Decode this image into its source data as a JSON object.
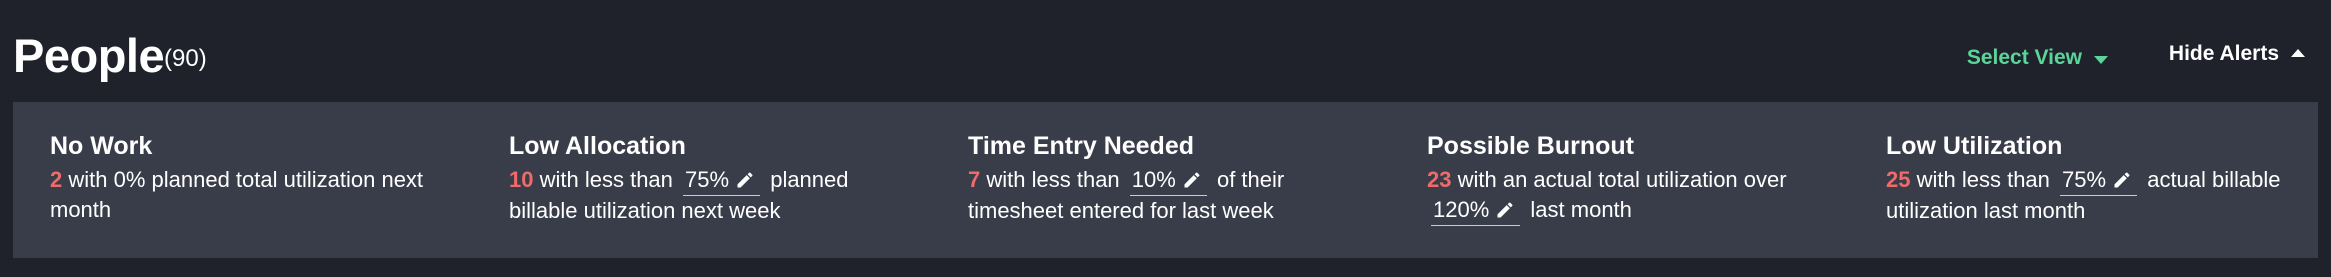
{
  "header": {
    "title": "People",
    "count": "(90)",
    "select_view_label": "Select View",
    "hide_alerts_label": "Hide Alerts"
  },
  "colors": {
    "background": "#1f222b",
    "panel": "#393d4a",
    "accent_green": "#5bd49a",
    "alert_red": "#f06a6a"
  },
  "alerts": [
    {
      "title": "No Work",
      "count": "2",
      "text_before": "with 0% planned total utilization next month"
    },
    {
      "title": "Low Allocation",
      "count": "10",
      "text_before": "with less than",
      "threshold": "75%",
      "text_after": "planned billable utilization next week"
    },
    {
      "title": "Time Entry Needed",
      "count": "7",
      "text_before": "with less than",
      "threshold": "10%",
      "text_after": "of their timesheet entered for last week"
    },
    {
      "title": "Possible Burnout",
      "count": "23",
      "text_before": "with an actual total utilization over",
      "threshold": "120%",
      "text_after": "last month"
    },
    {
      "title": "Low Utilization",
      "count": "25",
      "text_before": "with less than",
      "threshold": "75%",
      "text_after": "actual billable utilization last month"
    }
  ]
}
